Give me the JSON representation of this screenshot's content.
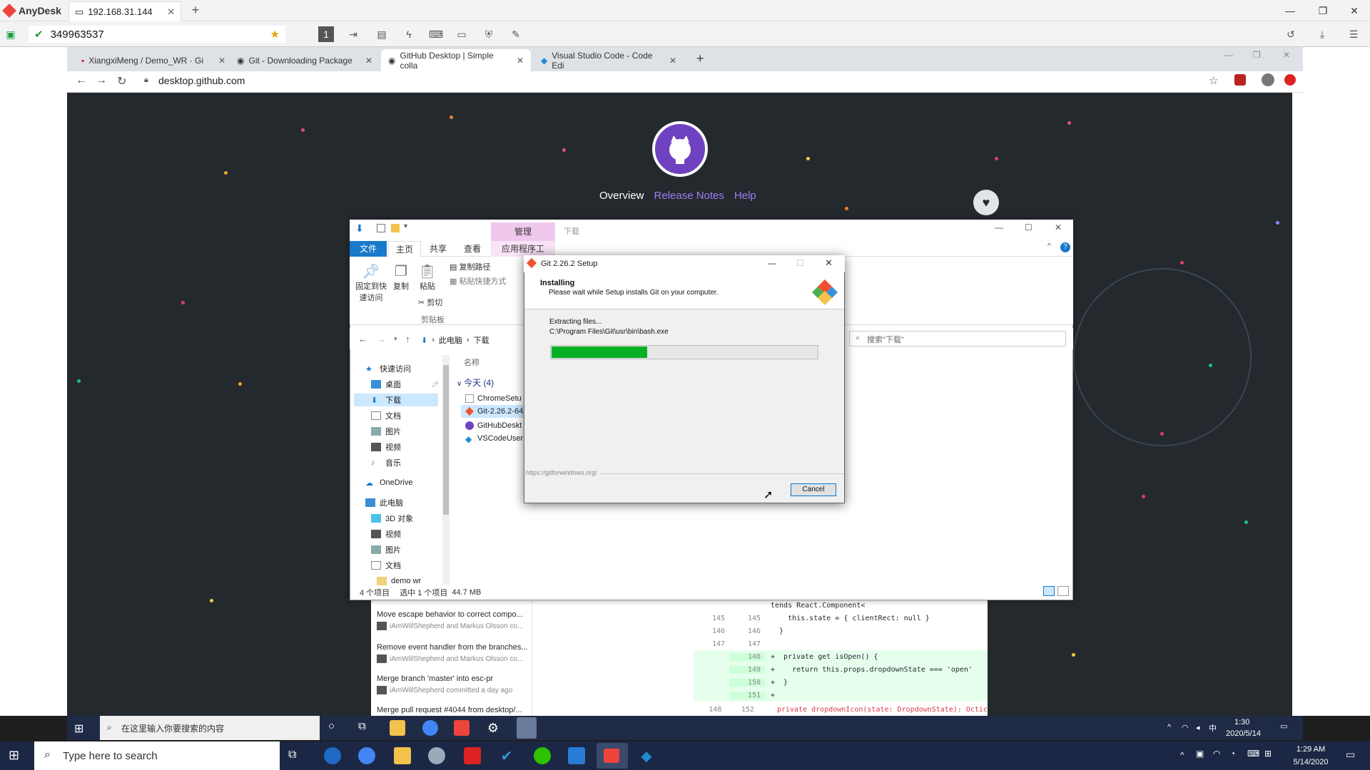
{
  "anydesk": {
    "app_name": "AnyDesk",
    "tab_label": "192.168.31.144",
    "address_value": "349963537"
  },
  "browser": {
    "tabs": [
      {
        "label": "XiangxiMeng / Demo_WR · Gi"
      },
      {
        "label": "Git - Downloading Package"
      },
      {
        "label": "GitHub Desktop | Simple colla"
      },
      {
        "label": "Visual Studio Code - Code Edi"
      }
    ],
    "url": "desktop.github.com"
  },
  "site": {
    "nav": {
      "overview": "Overview",
      "release_notes": "Release Notes",
      "help": "Help"
    }
  },
  "desktop_app": {
    "commits": [
      {
        "title": "Move escape behavior to correct compo...",
        "author": "iAmWillShepherd and Markus Olsson co..."
      },
      {
        "title": "Remove event handler from the branches...",
        "author": "iAmWillShepherd and Markus Olsson co..."
      },
      {
        "title": "Merge branch 'master' into esc-pr",
        "author": "iAmWillShepherd committed a day ago"
      },
      {
        "title": "Merge pull request #4044 from desktop/...",
        "author": ""
      }
    ],
    "diff": [
      {
        "old": "",
        "new": "",
        "code": "tends React.Component<",
        "type": "ctx"
      },
      {
        "old": "145",
        "new": "145",
        "code": "    this.state = { clientRect: null }",
        "type": "ctx"
      },
      {
        "old": "146",
        "new": "146",
        "code": "  }",
        "type": "ctx"
      },
      {
        "old": "147",
        "new": "147",
        "code": "",
        "type": "ctx"
      },
      {
        "old": "",
        "new": "148",
        "code": "+  private get isOpen() {",
        "type": "add"
      },
      {
        "old": "",
        "new": "149",
        "code": "+    return this.props.dropdownState === 'open'",
        "type": "add"
      },
      {
        "old": "",
        "new": "150",
        "code": "+  }",
        "type": "add"
      },
      {
        "old": "",
        "new": "151",
        "code": "+",
        "type": "add"
      },
      {
        "old": "148",
        "new": "152",
        "code": "   private dropdownIcon(state: DropdownState): Octic",
        "type": "ctx"
      }
    ]
  },
  "explorer": {
    "title_tab": "下载",
    "manage_tab": "管理",
    "ribbon_tabs": [
      "文件",
      "主页",
      "共享",
      "查看",
      "应用程序工具"
    ],
    "ribbon": {
      "pin": "固定到快速访问",
      "copy": "复制",
      "paste": "粘贴",
      "copy_path": "复制路径",
      "paste_shortcut": "粘贴快捷方式",
      "cut": "剪切",
      "group_clipboard": "剪贴板"
    },
    "breadcrumb": [
      "此电脑",
      "下载"
    ],
    "search_placeholder": "搜索\"下载\"",
    "column_name": "名称",
    "group_today": "今天 (4)",
    "sidebar": [
      "快速访问",
      "桌面",
      "下载",
      "文档",
      "图片",
      "视频",
      "音乐",
      "OneDrive",
      "此电脑",
      "3D 对象",
      "视频",
      "图片",
      "文档",
      "demo wr"
    ],
    "files": [
      "ChromeSetu",
      "Git-2.26.2-64",
      "GitHubDeskt",
      "VSCodeUser"
    ],
    "status": {
      "count": "4 个项目",
      "selected": "选中 1 个项目",
      "size": "44.7 MB"
    }
  },
  "git_setup": {
    "title": "Git 2.26.2 Setup",
    "heading": "Installing",
    "subheading": "Please wait while Setup installs Git on your computer.",
    "status": "Extracting files...",
    "path": "C:\\Program Files\\Git\\usr\\bin\\bash.exe",
    "progress": 0.36,
    "url": "https://gitforwindows.org/",
    "cancel": "Cancel"
  },
  "remote_taskbar": {
    "search": "在这里输入你要搜索的内容",
    "time": "1:30",
    "date": "2020/5/14",
    "ime": "中"
  },
  "local_taskbar": {
    "search": "Type here to search",
    "time": "1:29 AM",
    "date": "5/14/2020"
  },
  "colors": {
    "github_purple": "#6f42c1",
    "progress_green": "#06b025",
    "anydesk_red": "#ef443b"
  }
}
